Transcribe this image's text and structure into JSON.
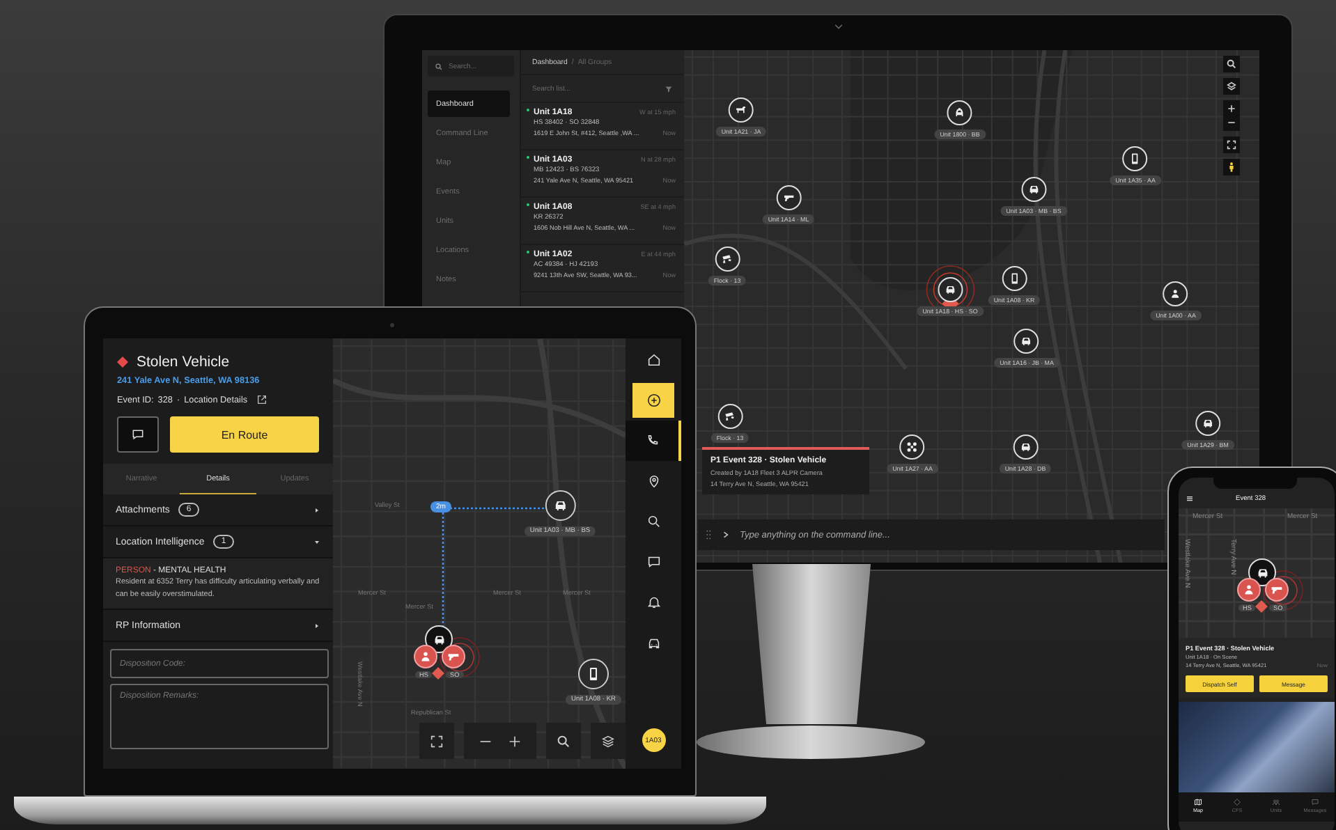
{
  "monitor": {
    "sidebar": {
      "search_placeholder": "Search...",
      "items": [
        {
          "label": "Dashboard",
          "selected": true
        },
        {
          "label": "Command Line",
          "selected": false
        },
        {
          "label": "Map",
          "selected": false
        },
        {
          "label": "Events",
          "selected": false
        },
        {
          "label": "Units",
          "selected": false
        },
        {
          "label": "Locations",
          "selected": false
        },
        {
          "label": "Notes",
          "selected": false
        }
      ]
    },
    "breadcrumb": {
      "root": "Dashboard",
      "separator": "/",
      "current": "All Groups"
    },
    "list": {
      "search_placeholder": "Search list...",
      "units": [
        {
          "name": "Unit 1A18",
          "heading": "W at 15 mph",
          "codes": "HS 38402 · SO 32848",
          "address": "1619 E John St, #412, Seattle ,WA ...",
          "time": "Now"
        },
        {
          "name": "Unit 1A03",
          "heading": "N at 28 mph",
          "codes": "MB 12423 · BS 76323",
          "address": "241 Yale Ave N, Seattle, WA 95421",
          "time": "Now"
        },
        {
          "name": "Unit 1A08",
          "heading": "SE at 4 mph",
          "codes": "KR 26372",
          "address": "1606 Nob Hill Ave N, Seattle, WA ...",
          "time": "Now"
        },
        {
          "name": "Unit 1A02",
          "heading": "E at 44 mph",
          "codes": "AC 49384 · HJ 42193",
          "address": "9241 13th Ave SW, Seattle, WA 93...",
          "time": "Now"
        }
      ]
    },
    "map": {
      "markers": [
        {
          "kind": "dog",
          "label": "Unit 1A21 · JA",
          "alert": false
        },
        {
          "kind": "taxi",
          "label": "Unit 1800 · BB",
          "alert": false
        },
        {
          "kind": "gun",
          "label": "Unit 1A14 · ML",
          "alert": false
        },
        {
          "kind": "car",
          "label": "Unit 1A03 · MB · BS",
          "alert": false
        },
        {
          "kind": "phone",
          "label": "Unit 1A35 · AA",
          "alert": false
        },
        {
          "kind": "camera",
          "label": "Flock · 13",
          "alert": false
        },
        {
          "kind": "car",
          "label": "Unit 1A18 · HS · SO",
          "alert": true
        },
        {
          "kind": "phone",
          "label": "Unit 1A08 · KR",
          "alert": false
        },
        {
          "kind": "person",
          "label": "Unit 1A00 · AA",
          "alert": false
        },
        {
          "kind": "car",
          "label": "Unit 1A16 · JB · MA",
          "alert": false
        },
        {
          "kind": "camera",
          "label": "Flock · 13",
          "alert": false
        },
        {
          "kind": "drone",
          "label": "Unit 1A27 · AA",
          "alert": false
        },
        {
          "kind": "car",
          "label": "Unit 1A28 · DB",
          "alert": false
        },
        {
          "kind": "car",
          "label": "Unit 1A29 · BM",
          "alert": false
        }
      ],
      "event_card": {
        "title": "P1 Event 328 · Stolen Vehicle",
        "created": "Created by 1A18 Fleet 3 ALPR Camera",
        "address": "14 Terry Ave N, Seattle, WA 95421"
      },
      "command_line": {
        "placeholder": "Type anything on the command line..."
      }
    }
  },
  "laptop": {
    "incident": {
      "title": "Stolen Vehicle",
      "address": "241 Yale Ave N, Seattle, WA 98136",
      "event_id_label": "Event ID:",
      "event_id": "328",
      "separator": "·",
      "location_details": "Location Details",
      "status_button": "En Route"
    },
    "tabs": [
      {
        "label": "Narrative",
        "selected": false
      },
      {
        "label": "Details",
        "selected": true
      },
      {
        "label": "Updates",
        "selected": false
      }
    ],
    "sections": [
      {
        "title": "Attachments",
        "count": "6",
        "expanded": false
      },
      {
        "title": "Location Intelligence",
        "count": "1",
        "expanded": true,
        "note": {
          "category": "PERSON",
          "type": " - MENTAL HEALTH",
          "text": "Resident at 6352 Terry has difficulty articulating verbally and can be easily overstimulated."
        }
      },
      {
        "title": "RP Information",
        "expanded": false
      }
    ],
    "fields": [
      {
        "kind": "input",
        "placeholder": "Disposition Code:"
      },
      {
        "kind": "textarea",
        "placeholder": "Disposition Remarks:"
      }
    ],
    "map": {
      "route_eta": "2m",
      "streets": [
        "Valley St",
        "Mercer St",
        "Mercer St",
        "Mercer St",
        "Mercer St",
        "Republican St",
        "Westlake Ave N"
      ],
      "markers": [
        {
          "kind": "car",
          "label": "Unit 1A03 · MB · BS"
        },
        {
          "kind": "phone",
          "label": "Unit 1A08 · KR"
        }
      ],
      "cluster_labels": [
        "HS",
        "SO"
      ]
    },
    "rail": [
      {
        "kind": "home",
        "selected": false
      },
      {
        "kind": "add",
        "selected": false
      },
      {
        "kind": "call",
        "selected": true
      },
      {
        "kind": "pin",
        "selected": false
      },
      {
        "kind": "search",
        "selected": false
      },
      {
        "kind": "chat",
        "selected": false
      },
      {
        "kind": "bell",
        "selected": false
      },
      {
        "kind": "car",
        "selected": false
      }
    ],
    "avatar": "1A03"
  },
  "phone": {
    "title": "Event 328",
    "streets": [
      "Mercer St",
      "Mercer St",
      "Westlake Ave N",
      "Terry Ave N"
    ],
    "cluster_labels": [
      "HS",
      "SO"
    ],
    "card": {
      "title": "P1 Event 328 · Stolen Vehicle",
      "status": "Unit 1A18 · On Scene",
      "address": "14 Terry Ave N, Seattle, WA 95421",
      "time": "Now"
    },
    "buttons": [
      "Dispatch Self",
      "Message"
    ],
    "tabs": [
      {
        "kind": "map",
        "label": "Map",
        "selected": true
      },
      {
        "kind": "cfs",
        "label": "CFS",
        "selected": false
      },
      {
        "kind": "units",
        "label": "Units",
        "selected": false
      },
      {
        "kind": "messages",
        "label": "Messages",
        "selected": false
      }
    ]
  }
}
